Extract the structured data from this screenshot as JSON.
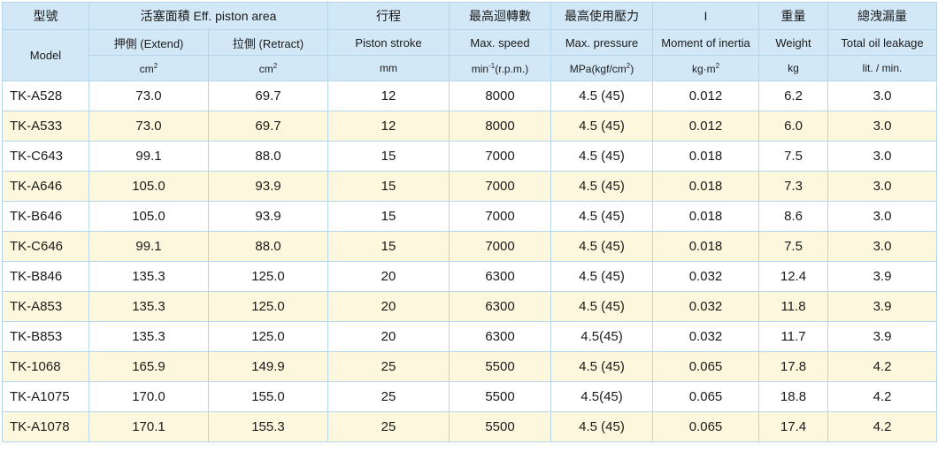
{
  "header": {
    "model_zh": "型號",
    "model_en": "Model",
    "area_zh": "活塞面積",
    "area_en": "Eff. piston area",
    "extend_zh": "押側",
    "extend_en": "(Extend)",
    "retract_zh": "拉側",
    "retract_en": "(Retract)",
    "area_unit_base": "cm",
    "area_unit_exp": "2",
    "stroke_zh": "行程",
    "stroke_en": "Piston stroke",
    "stroke_unit": "mm",
    "speed_zh": "最高迴轉數",
    "speed_en": "Max. speed",
    "speed_unit_a": "min",
    "speed_unit_exp": "-1",
    "speed_unit_b": "(r.p.m.)",
    "pressure_zh": "最高使用壓力",
    "pressure_en": "Max. pressure",
    "pressure_unit_a": "MPa(kgf/cm",
    "pressure_unit_exp": "2",
    "pressure_unit_b": ")",
    "inertia_zh": "I",
    "inertia_en": "Moment of inertia",
    "inertia_unit_a": "kg·m",
    "inertia_unit_exp": "2",
    "weight_zh": "重量",
    "weight_en": "Weight",
    "weight_unit": "kg",
    "leak_zh": "總洩漏量",
    "leak_en": "Total oil leakage",
    "leak_unit": "lit. / min."
  },
  "rows": [
    {
      "model": "TK-A528",
      "extend": "73.0",
      "retract": "69.7",
      "stroke": "12",
      "speed": "8000",
      "pressure": "4.5 (45)",
      "inertia": "0.012",
      "weight": "6.2",
      "leak": "3.0"
    },
    {
      "model": "TK-A533",
      "extend": "73.0",
      "retract": "69.7",
      "stroke": "12",
      "speed": "8000",
      "pressure": "4.5 (45)",
      "inertia": "0.012",
      "weight": "6.0",
      "leak": "3.0"
    },
    {
      "model": "TK-C643",
      "extend": "99.1",
      "retract": "88.0",
      "stroke": "15",
      "speed": "7000",
      "pressure": "4.5 (45)",
      "inertia": "0.018",
      "weight": "7.5",
      "leak": "3.0"
    },
    {
      "model": "TK-A646",
      "extend": "105.0",
      "retract": "93.9",
      "stroke": "15",
      "speed": "7000",
      "pressure": "4.5 (45)",
      "inertia": "0.018",
      "weight": "7.3",
      "leak": "3.0"
    },
    {
      "model": "TK-B646",
      "extend": "105.0",
      "retract": "93.9",
      "stroke": "15",
      "speed": "7000",
      "pressure": "4.5 (45)",
      "inertia": "0.018",
      "weight": "8.6",
      "leak": "3.0"
    },
    {
      "model": "TK-C646",
      "extend": "99.1",
      "retract": "88.0",
      "stroke": "15",
      "speed": "7000",
      "pressure": "4.5 (45)",
      "inertia": "0.018",
      "weight": "7.5",
      "leak": "3.0"
    },
    {
      "model": "TK-B846",
      "extend": "135.3",
      "retract": "125.0",
      "stroke": "20",
      "speed": "6300",
      "pressure": "4.5 (45)",
      "inertia": "0.032",
      "weight": "12.4",
      "leak": "3.9"
    },
    {
      "model": "TK-A853",
      "extend": "135.3",
      "retract": "125.0",
      "stroke": "20",
      "speed": "6300",
      "pressure": "4.5 (45)",
      "inertia": "0.032",
      "weight": "11.8",
      "leak": "3.9"
    },
    {
      "model": "TK-B853",
      "extend": "135.3",
      "retract": "125.0",
      "stroke": "20",
      "speed": "6300",
      "pressure": "4.5(45)",
      "inertia": "0.032",
      "weight": "11.7",
      "leak": "3.9"
    },
    {
      "model": "TK-1068",
      "extend": "165.9",
      "retract": "149.9",
      "stroke": "25",
      "speed": "5500",
      "pressure": "4.5 (45)",
      "inertia": "0.065",
      "weight": "17.8",
      "leak": "4.2"
    },
    {
      "model": "TK-A1075",
      "extend": "170.0",
      "retract": "155.0",
      "stroke": "25",
      "speed": "5500",
      "pressure": "4.5(45)",
      "inertia": "0.065",
      "weight": "18.8",
      "leak": "4.2"
    },
    {
      "model": "TK-A1078",
      "extend": "170.1",
      "retract": "155.3",
      "stroke": "25",
      "speed": "5500",
      "pressure": "4.5 (45)",
      "inertia": "0.065",
      "weight": "17.4",
      "leak": "4.2"
    }
  ],
  "colors": {
    "header_bg": "#d3e8f7",
    "border": "#b6d6ec",
    "stripe_bg": "#fdf8dd",
    "row_bg": "#ffffff"
  }
}
